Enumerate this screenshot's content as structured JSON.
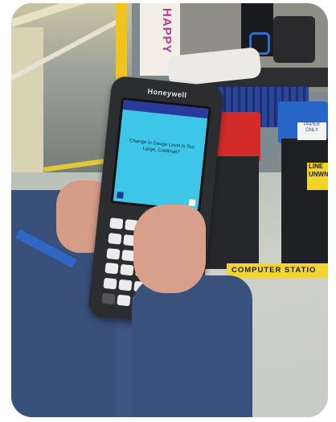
{
  "scene": {
    "device_brand": "Honeywell",
    "screen_message": "Change In Gauge Level Is Too Large, Continue?",
    "banner_text": "HAPPY",
    "floor_tape_text": "COMPUTER STATIO",
    "line_sign_text": "LINE\nUNWN",
    "bin_tag_text": "PAPER\nONLY",
    "colors": {
      "screen": "#3ec6e8",
      "floor_tape": "#f2d432",
      "red_bin_lid": "#d32a2a",
      "blue_bin_lid": "#2766c6",
      "sleeve": "#3a517d"
    }
  }
}
